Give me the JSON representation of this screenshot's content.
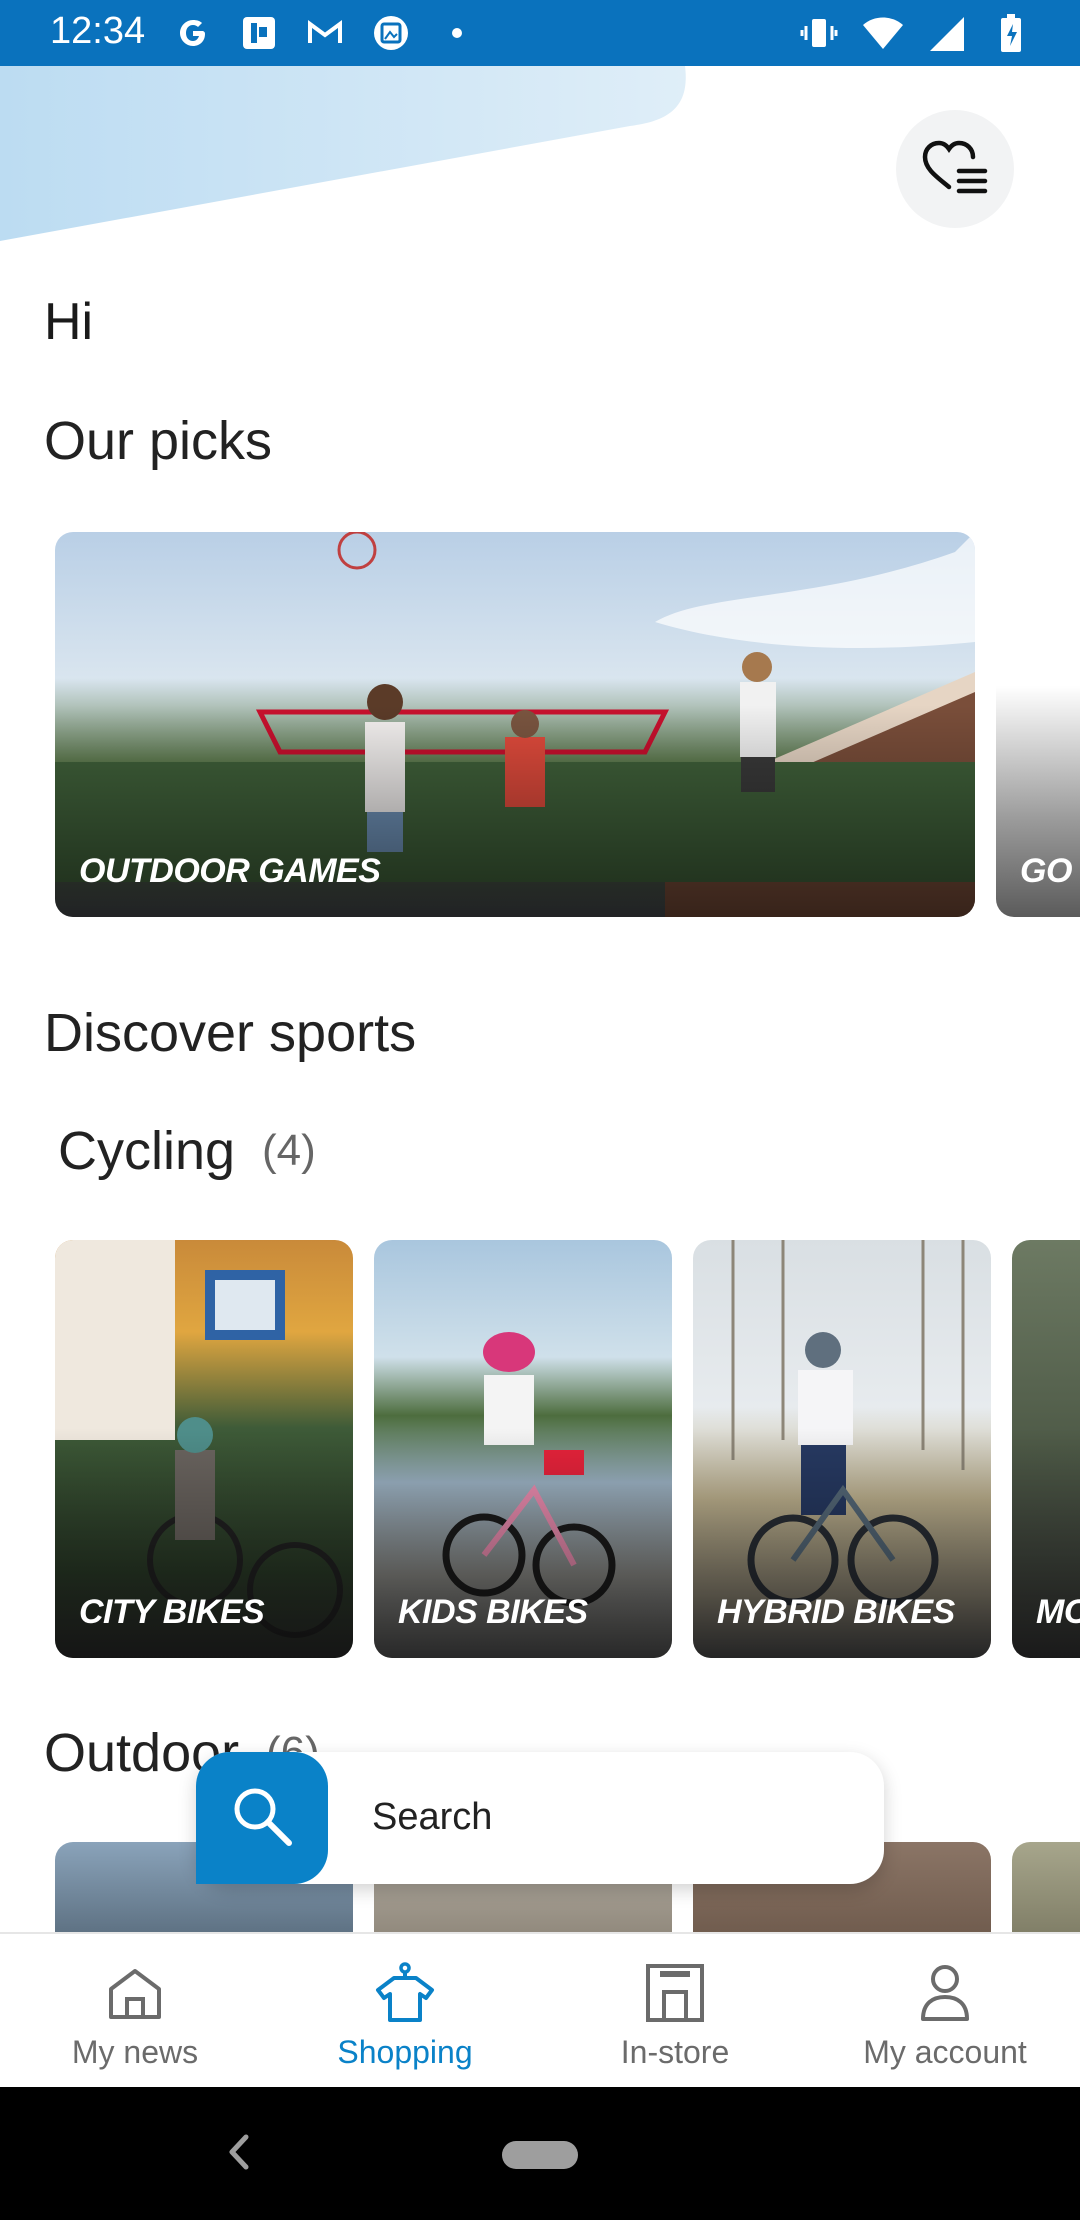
{
  "status_bar": {
    "time": "12:34",
    "left_icons": [
      "google-icon",
      "app-icon",
      "gmail-icon",
      "photo-icon",
      "dot-icon"
    ],
    "right_icons": [
      "vibrate-icon",
      "wifi-icon",
      "signal-icon",
      "battery-charging-icon"
    ]
  },
  "header": {
    "greeting": "Hi",
    "wishlist_icon": "heart-list-icon"
  },
  "picks": {
    "title": "Our picks",
    "cards": [
      {
        "label": "OUTDOOR GAMES"
      },
      {
        "label": "GO F"
      }
    ]
  },
  "discover": {
    "title": "Discover sports",
    "cycling": {
      "title": "Cycling",
      "count": "(4)",
      "cards": [
        {
          "label": "CITY BIKES"
        },
        {
          "label": "KIDS BIKES"
        },
        {
          "label": "HYBRID BIKES"
        },
        {
          "label": "MO"
        }
      ]
    },
    "outdoor": {
      "title": "Outdoor",
      "count": "(6)"
    }
  },
  "search": {
    "placeholder": "Search"
  },
  "bottom_nav": {
    "items": [
      {
        "label": "My news",
        "icon": "home-icon",
        "active": false
      },
      {
        "label": "Shopping",
        "icon": "shirt-icon",
        "active": true
      },
      {
        "label": "In-store",
        "icon": "store-icon",
        "active": false
      },
      {
        "label": "My account",
        "icon": "user-icon",
        "active": false
      }
    ]
  },
  "colors": {
    "brand_blue": "#0a82c8",
    "status_bar": "#0a72bd",
    "inactive_nav": "#6b6b6b"
  }
}
